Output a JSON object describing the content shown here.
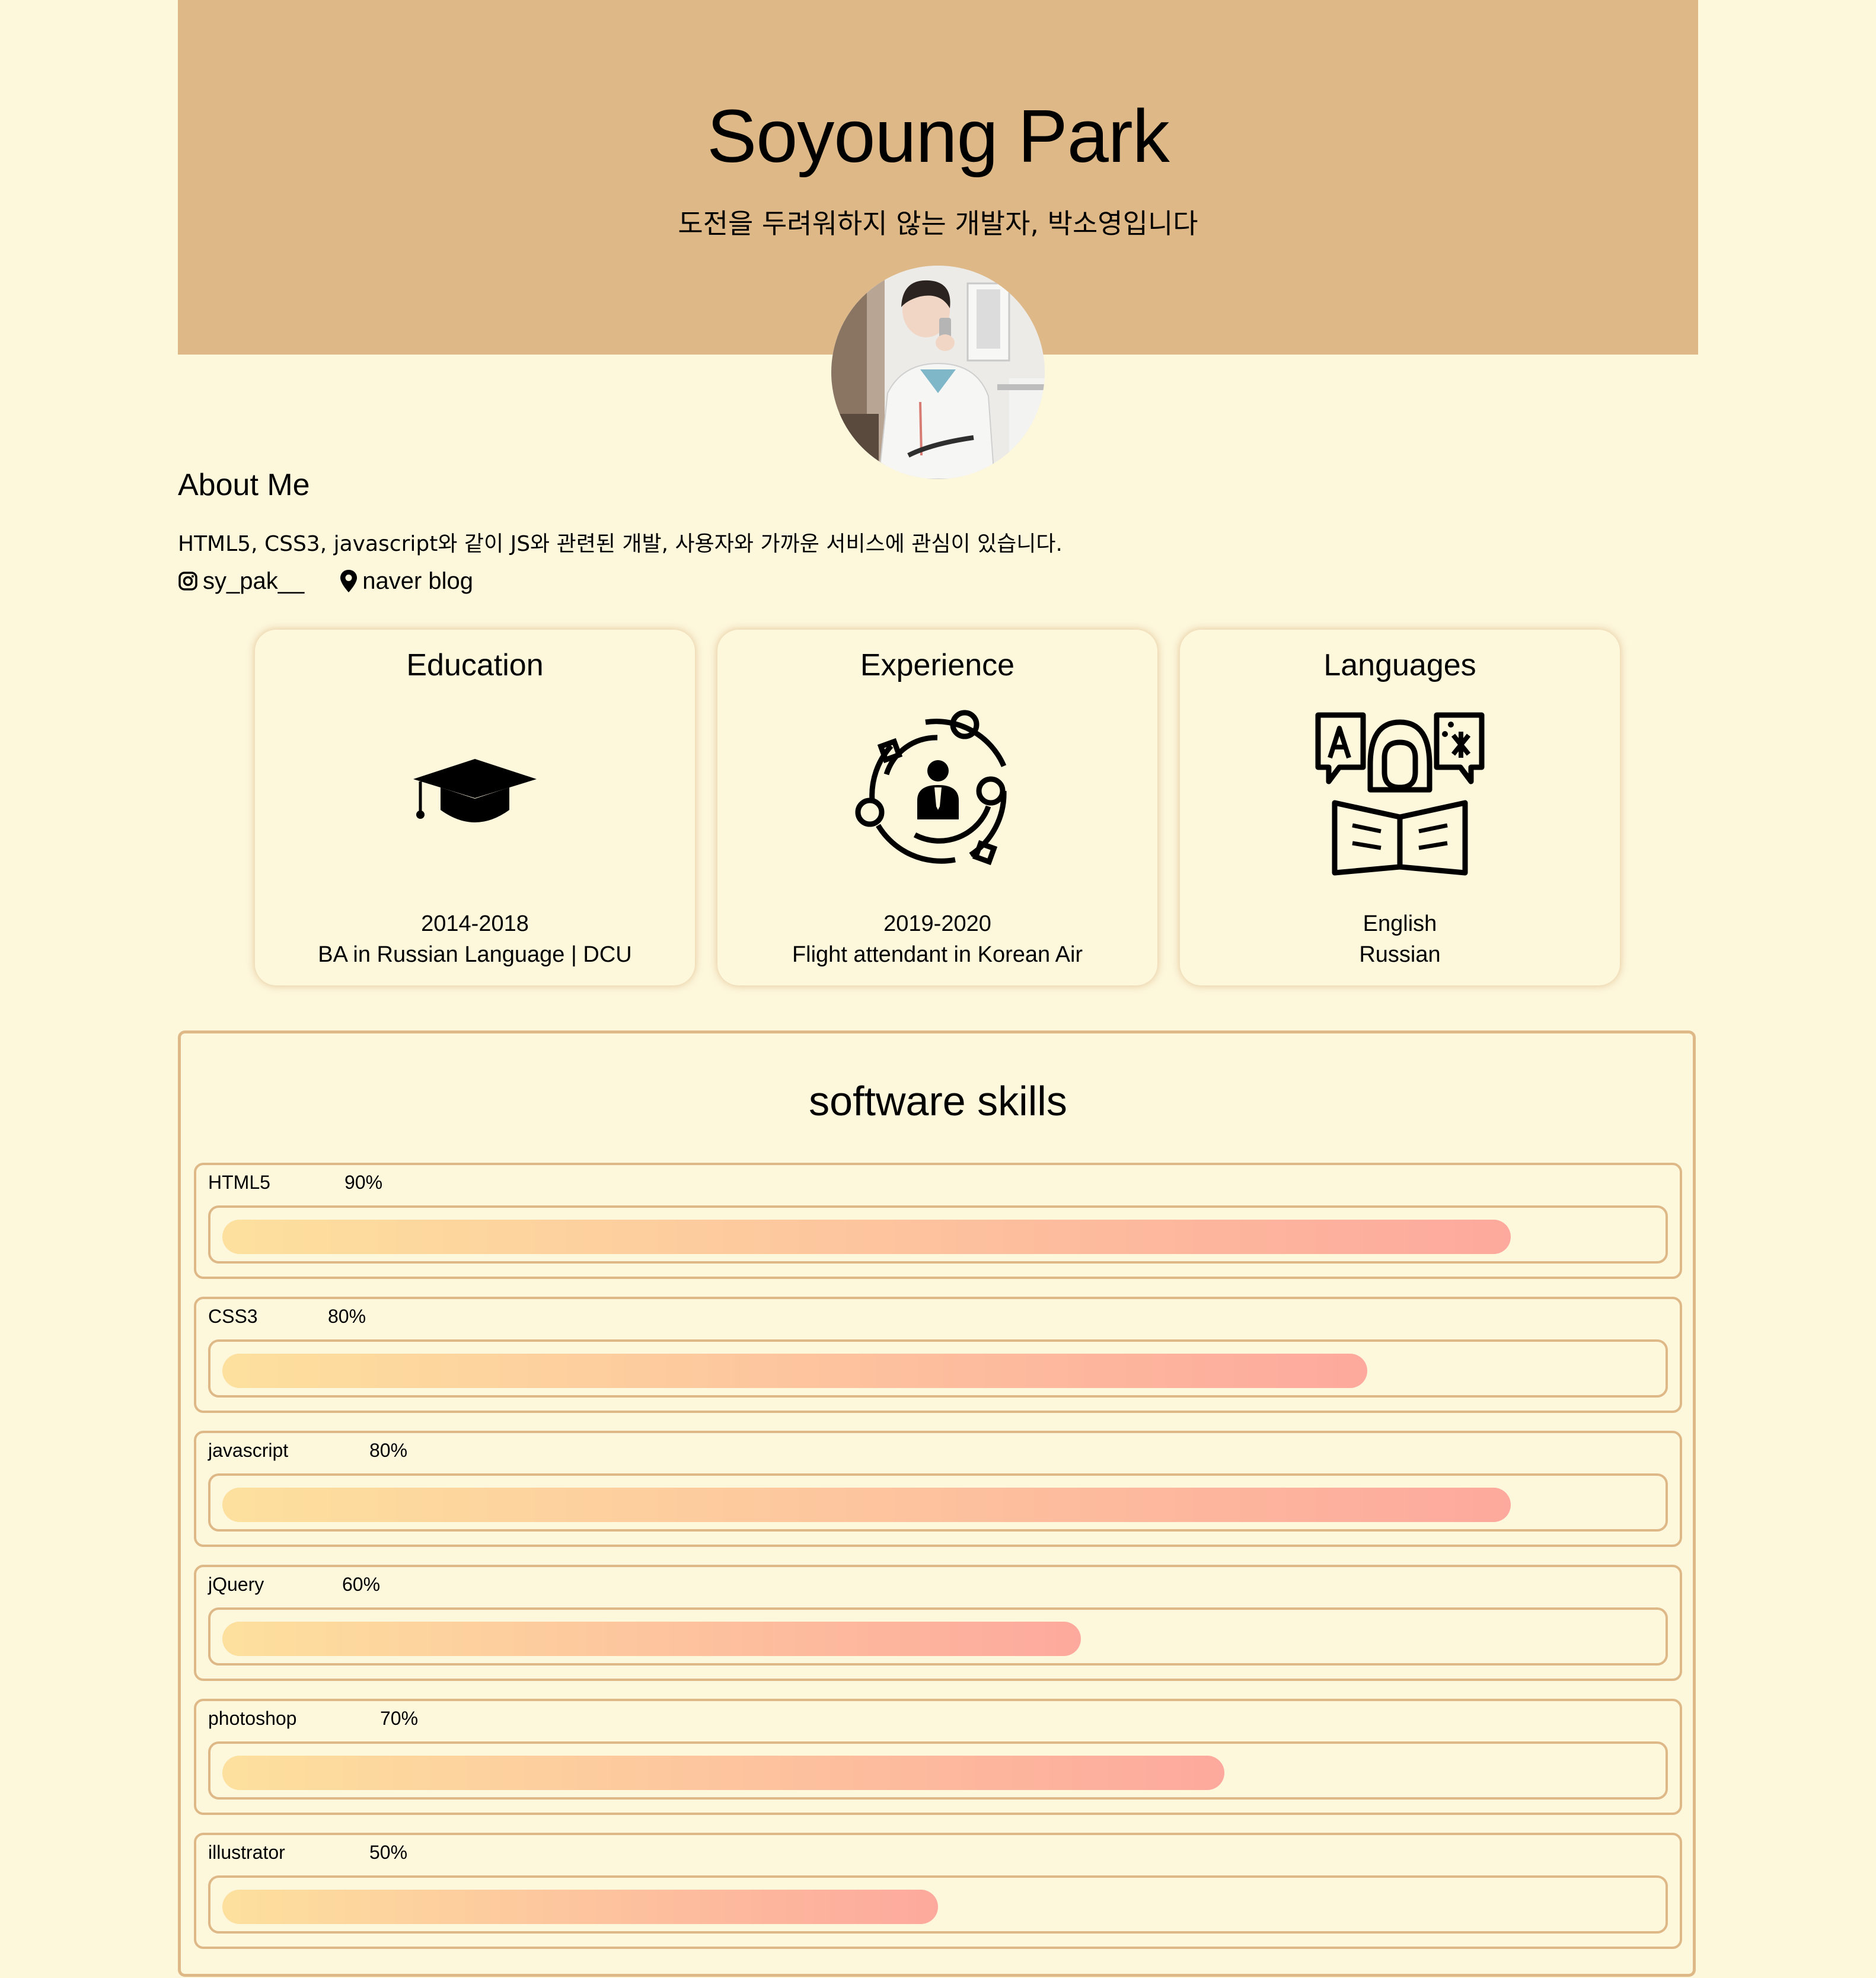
{
  "header": {
    "name": "Soyoung Park",
    "tagline": "도전을 두려워하지 않는 개발자, 박소영입니다"
  },
  "avatar": {
    "alt": "profile photo"
  },
  "about": {
    "title": "About Me",
    "text": "HTML5, CSS3, javascript와 같이 JS와 관련된 개발, 사용자와 가까운 서비스에 관심이 있습니다.",
    "links": [
      {
        "icon": "instagram-icon",
        "label": "sy_pak__"
      },
      {
        "icon": "location-pin-icon",
        "label": "naver blog"
      }
    ]
  },
  "cards": [
    {
      "title": "Education",
      "icon": "graduation-cap-icon",
      "line1": "2014-2018",
      "line2": "BA in Russian Language | DCU"
    },
    {
      "title": "Experience",
      "icon": "businessman-cycle-icon",
      "line1": "2019-2020",
      "line2": "Flight attendant in Korean Air"
    },
    {
      "title": "Languages",
      "icon": "reader-speech-bubbles-icon",
      "line1": "English",
      "line2": "Russian"
    }
  ],
  "skills": {
    "title": "software skills",
    "items": [
      {
        "name": "HTML5",
        "percent_label": "90%",
        "fill": 0.9
      },
      {
        "name": "CSS3",
        "percent_label": "80%",
        "fill": 0.8
      },
      {
        "name": "javascript",
        "percent_label": "80%",
        "fill": 0.9
      },
      {
        "name": "jQuery",
        "percent_label": "60%",
        "fill": 0.6
      },
      {
        "name": "photoshop",
        "percent_label": "70%",
        "fill": 0.7
      },
      {
        "name": "illustrator",
        "percent_label": "50%",
        "fill": 0.5
      }
    ]
  },
  "colors": {
    "background": "#fdf7dc",
    "header": "#deb887",
    "border": "#deb887",
    "bar_start": "#fde09e",
    "bar_end": "#fda99d"
  }
}
